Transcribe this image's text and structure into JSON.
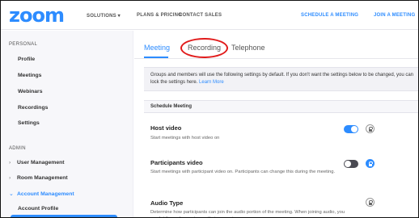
{
  "header": {
    "logo": "zoom",
    "nav": {
      "solutions": "SOLUTIONS ▾",
      "plans": "PLANS & PRICING",
      "contact": "CONTACT SALES",
      "schedule": "SCHEDULE A MEETING",
      "join": "JOIN A MEETING"
    }
  },
  "sidebar": {
    "personal_label": "PERSONAL",
    "personal_items": [
      "Profile",
      "Meetings",
      "Webinars",
      "Recordings",
      "Settings"
    ],
    "admin_label": "ADMIN",
    "admin_items": [
      "User Management",
      "Room Management",
      "Account Management"
    ],
    "sub_items": [
      "Account Profile"
    ],
    "expand_icons": {
      "collapsed": "›",
      "expanded": "⌄"
    }
  },
  "tabs": [
    "Meeting",
    "Recording",
    "Telephone"
  ],
  "info_text": "Groups and members will use the following settings by default. If you don't want the settings below to be changed, you can lock the settings here.",
  "info_link": "Learn More",
  "section_title": "Schedule Meeting",
  "settings": [
    {
      "title": "Host video",
      "desc": "Start meetings with host video on",
      "toggle": "on"
    },
    {
      "title": "Participants video",
      "desc": "Start meetings with participant video on. Participants can change this during the meeting.",
      "toggle": "off"
    },
    {
      "title": "Audio Type",
      "desc": "Determine how participants can join the audio portion of the meeting. When joining audio, you can let them choose to use their computer"
    }
  ],
  "colors": {
    "accent": "#2d8cff",
    "highlight": "#e11b1b"
  }
}
